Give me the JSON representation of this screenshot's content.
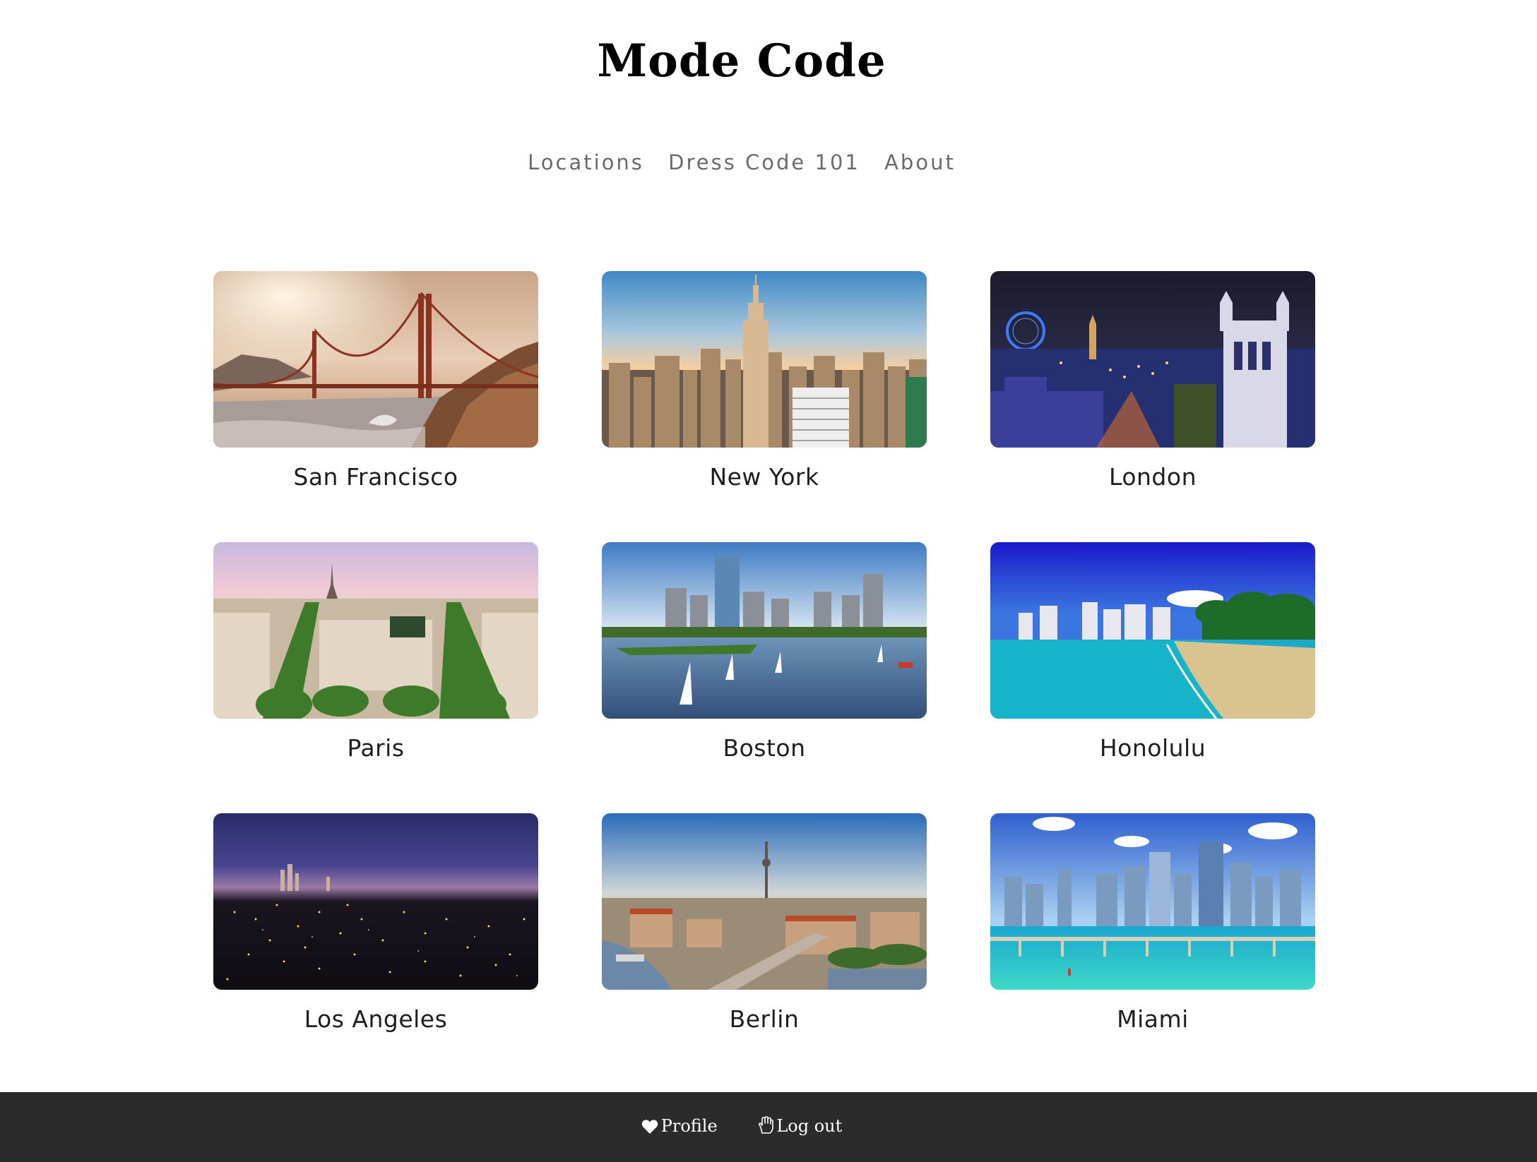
{
  "site": {
    "title": "Mode Code"
  },
  "nav": {
    "items": [
      {
        "label": "Locations"
      },
      {
        "label": "Dress Code 101"
      },
      {
        "label": "About"
      }
    ]
  },
  "locations": [
    {
      "label": "San Francisco"
    },
    {
      "label": "New York"
    },
    {
      "label": "London"
    },
    {
      "label": "Paris"
    },
    {
      "label": "Boston"
    },
    {
      "label": "Honolulu"
    },
    {
      "label": "Los Angeles"
    },
    {
      "label": "Berlin"
    },
    {
      "label": "Miami"
    }
  ],
  "footer": {
    "profile_label": "Profile",
    "profile_icon": "heart-icon",
    "logout_label": "Log out",
    "logout_icon": "hand-icon"
  },
  "colors": {
    "footer_bg": "#2b2b2b",
    "nav_text": "#6b6b6b",
    "title_text": "#000000"
  }
}
